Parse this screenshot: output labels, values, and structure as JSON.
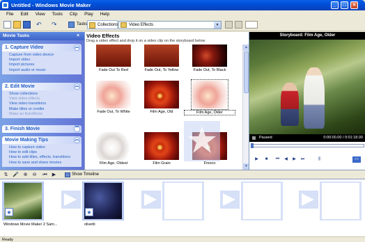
{
  "window": {
    "title": "Untitled - Windows Movie Maker",
    "min": "_",
    "max": "□",
    "close": "×"
  },
  "menu": [
    "File",
    "Edit",
    "View",
    "Tools",
    "Clip",
    "Play",
    "Help"
  ],
  "toolbar": {
    "tasks_label": "Tasks",
    "collections_label": "Collections",
    "collection_value": "Video Effects"
  },
  "task_pane": {
    "header": "Movie Tasks",
    "sections": [
      {
        "title": "1. Capture Video",
        "links": [
          {
            "label": "Capture from video device",
            "enabled": true
          },
          {
            "label": "Import video",
            "enabled": true
          },
          {
            "label": "Import pictures",
            "enabled": true
          },
          {
            "label": "Import audio or music",
            "enabled": true
          }
        ]
      },
      {
        "title": "2. Edit Movie",
        "links": [
          {
            "label": "Show collections",
            "enabled": true
          },
          {
            "label": "View video effects",
            "enabled": false
          },
          {
            "label": "View video transitions",
            "enabled": true
          },
          {
            "label": "Make titles or credits",
            "enabled": true
          },
          {
            "label": "Make an AutoMovie",
            "enabled": false
          }
        ]
      },
      {
        "title": "3. Finish Movie",
        "links": []
      },
      {
        "title": "Movie Making Tips",
        "links": [
          {
            "label": "How to capture video",
            "enabled": true
          },
          {
            "label": "How to edit clips",
            "enabled": true
          },
          {
            "label": "How to add titles, effects, transitions",
            "enabled": true
          },
          {
            "label": "How to save and share movies",
            "enabled": true
          }
        ]
      }
    ]
  },
  "effects": {
    "title": "Video Effects",
    "hint": "Drag a video effect and drop it on a video clip on the storyboard below",
    "items": [
      {
        "label": "Fade Out To Red",
        "style": "flower-top"
      },
      {
        "label": "Fade Out, To Yellow",
        "style": "flower-top"
      },
      {
        "label": "Fade Out, To Black",
        "style": "flower-top"
      },
      {
        "label": "Fade Out, To White",
        "style": "flower-pale"
      },
      {
        "label": "Film Age, Old",
        "style": "flower"
      },
      {
        "label": "Film Age, Older",
        "style": "flower-pale",
        "selected": true
      },
      {
        "label": "Film Age, Oldest",
        "style": "flower-white"
      },
      {
        "label": "Film Grain",
        "style": "flower"
      },
      {
        "label": "Fresco",
        "style": "flower"
      }
    ]
  },
  "monitor": {
    "title": "Storyboard: Film Age, Older",
    "status": "Paused",
    "timecode": "0:00:00.00 / 0:01:18.00",
    "controls": [
      "play-icon",
      "stop-icon",
      "prev-icon",
      "back-frame-icon",
      "fwd-frame-icon",
      "next-icon",
      "split-icon",
      "snapshot-icon"
    ]
  },
  "timeline_toolbar": {
    "show_timeline": "Show Timeline"
  },
  "storyboard": {
    "clips": [
      {
        "label": "Windows Movie Maker 2 Sam...",
        "has_clip": true
      },
      {
        "label": "olivetti",
        "has_clip": true
      },
      {
        "label": "",
        "has_clip": false
      },
      {
        "label": "",
        "has_clip": false
      },
      {
        "label": "",
        "has_clip": false
      }
    ]
  },
  "statusbar": {
    "text": "Ready"
  }
}
